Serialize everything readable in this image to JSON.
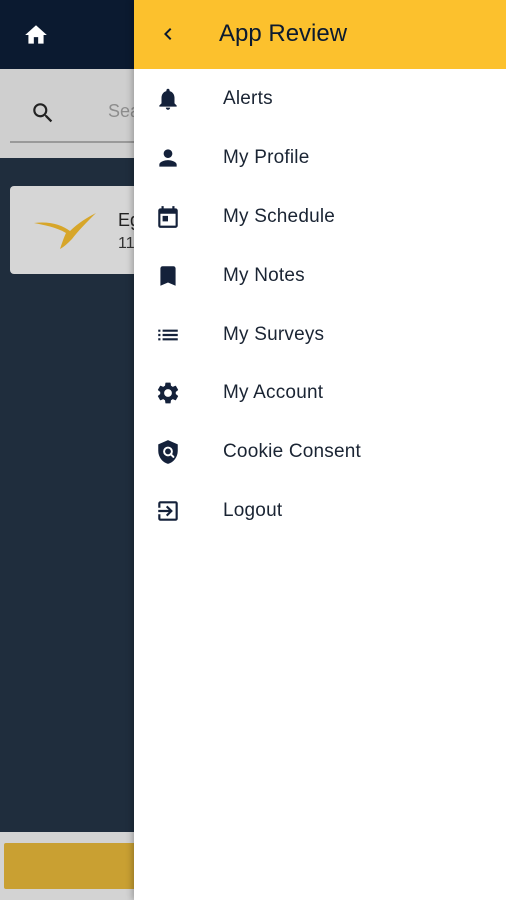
{
  "background": {
    "search_placeholder_partial": "Sea",
    "card_title_partial": "Eg",
    "card_sub_partial": "11",
    "colors": {
      "topbar": "#0b1a30",
      "content": "#1f2d3d",
      "accent": "#c9a032"
    }
  },
  "drawer": {
    "title": "App Review",
    "back_icon": "chevron-left-icon",
    "header_color": "#fcc12d",
    "items": [
      {
        "label": "Alerts",
        "icon": "bell-icon"
      },
      {
        "label": "My Profile",
        "icon": "person-icon"
      },
      {
        "label": "My Schedule",
        "icon": "calendar-icon"
      },
      {
        "label": "My Notes",
        "icon": "bookmark-icon"
      },
      {
        "label": "My Surveys",
        "icon": "list-icon"
      },
      {
        "label": "My Account",
        "icon": "gear-icon"
      },
      {
        "label": "Cookie Consent",
        "icon": "shield-icon"
      },
      {
        "label": "Logout",
        "icon": "logout-icon"
      }
    ]
  }
}
